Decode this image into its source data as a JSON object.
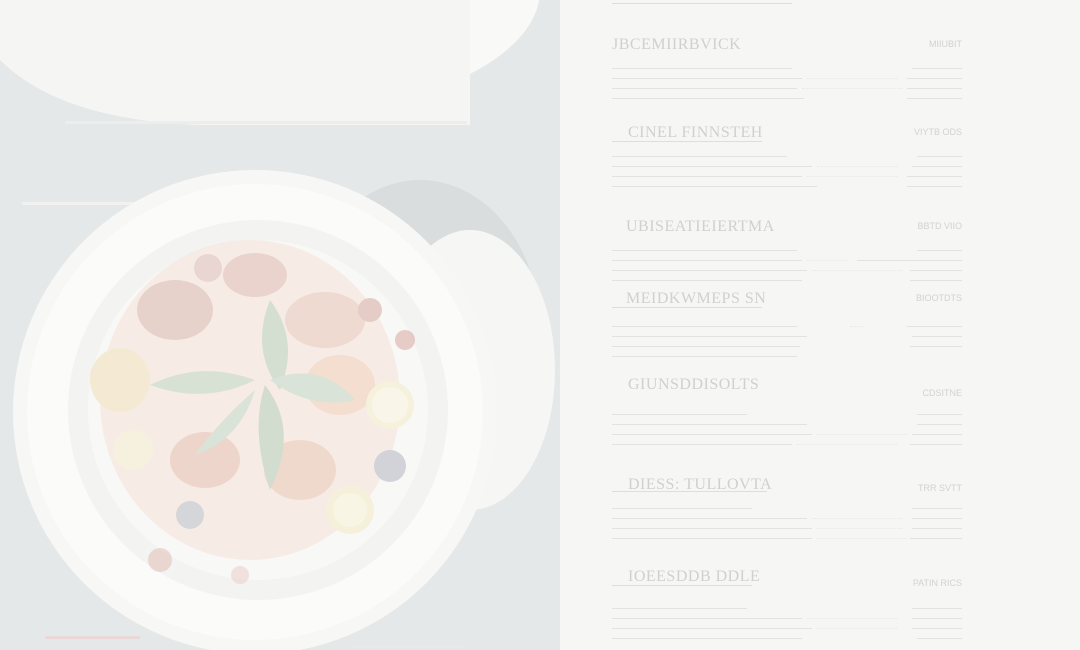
{
  "menu": {
    "sections": [
      {
        "title": "JBCEMIIRBVICK",
        "price": "MIIUBIT"
      },
      {
        "title": "CINEL FINNSTEH",
        "price": "VIYTB ODS"
      },
      {
        "title": "UBISEATIEIERTMA",
        "price": "BBTD VIIO"
      },
      {
        "title": "MEIDKWMEPS SN",
        "price": "BIOOTDTS"
      },
      {
        "title": "GIUNSDDISOLTS",
        "price": "CDSITNE"
      },
      {
        "title": "DIESS: TULLOVTA",
        "price": "TRR SVTT"
      },
      {
        "title": "IOEESDDB DDLE",
        "price": "PATIN RICS"
      }
    ]
  },
  "colors": {
    "background": "#f6f6f4",
    "plate": "#fbfbfa",
    "shadow": "#e7e9e8",
    "accent_slate": "#dfe3e3"
  }
}
